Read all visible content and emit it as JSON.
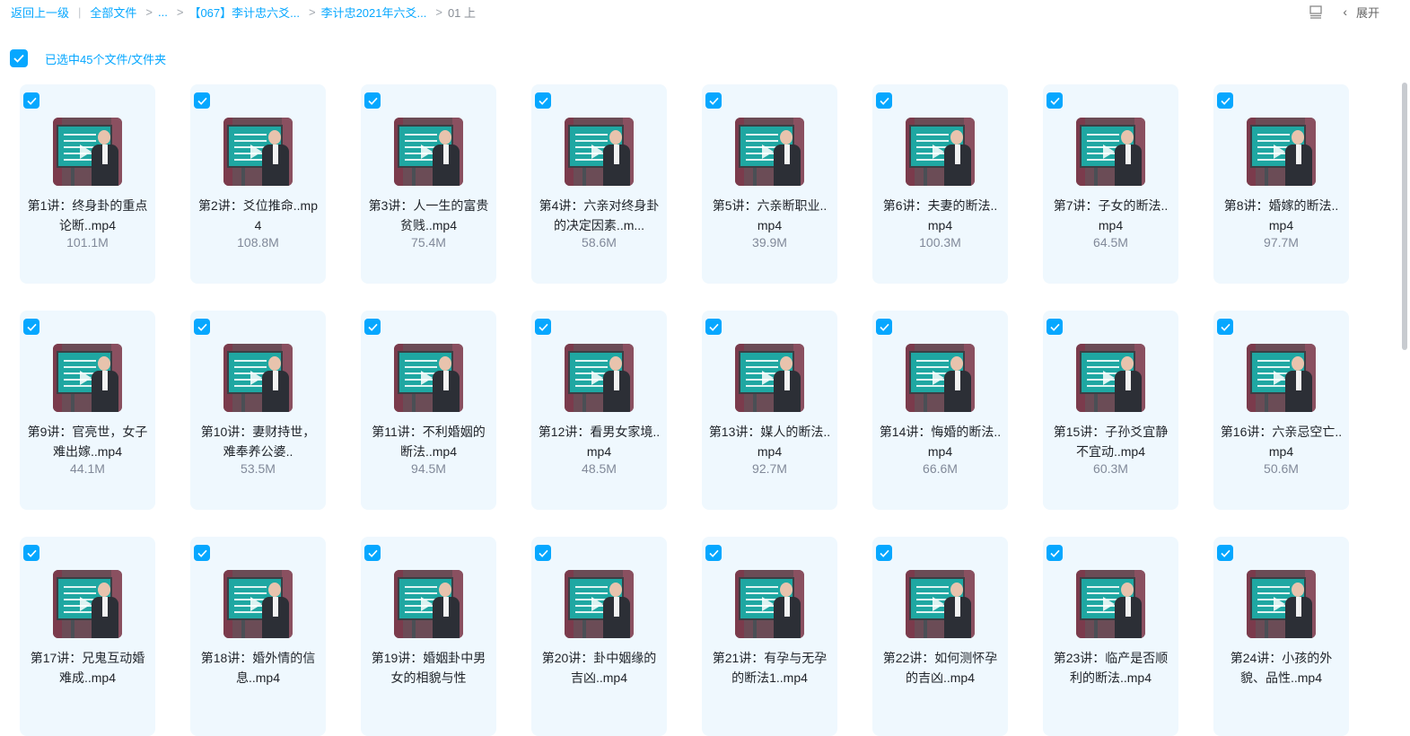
{
  "breadcrumb": {
    "back": "返回上一级",
    "all_files": "全部文件",
    "ellipsis": "...",
    "folder1": "【067】李计忠六爻...",
    "folder2": "李计忠2021年六爻...",
    "current": "01 上"
  },
  "toolbar": {
    "view_icon": "list-view-icon",
    "expand_label": "展开"
  },
  "selection": {
    "label": "已选中45个文件/文件夹",
    "all_checked": true
  },
  "colors": {
    "accent": "#06a7ff",
    "card_bg": "#eff8fe"
  },
  "files": [
    {
      "name": "第1讲：终身卦的重点论断..mp4",
      "size": "101.1M"
    },
    {
      "name": "第2讲：爻位推命..mp4",
      "size": "108.8M"
    },
    {
      "name": "第3讲：人一生的富贵贫贱..mp4",
      "size": "75.4M"
    },
    {
      "name": "第4讲：六亲对终身卦的决定因素..m...",
      "size": "58.6M"
    },
    {
      "name": "第5讲：六亲断职业..mp4",
      "size": "39.9M"
    },
    {
      "name": "第6讲：夫妻的断法..mp4",
      "size": "100.3M"
    },
    {
      "name": "第7讲：子女的断法..mp4",
      "size": "64.5M"
    },
    {
      "name": "第8讲：婚嫁的断法..mp4",
      "size": "97.7M"
    },
    {
      "name": "第9讲：官亮世，女子难出嫁..mp4",
      "size": "44.1M"
    },
    {
      "name": "第10讲：妻财持世，难奉养公婆..",
      "size": "53.5M"
    },
    {
      "name": "第11讲：不利婚姻的断法..mp4",
      "size": "94.5M"
    },
    {
      "name": "第12讲：看男女家境..mp4",
      "size": "48.5M"
    },
    {
      "name": "第13讲：媒人的断法..mp4",
      "size": "92.7M"
    },
    {
      "name": "第14讲：悔婚的断法..mp4",
      "size": "66.6M"
    },
    {
      "name": "第15讲：子孙爻宜静不宜动..mp4",
      "size": "60.3M"
    },
    {
      "name": "第16讲：六亲忌空亡..mp4",
      "size": "50.6M"
    },
    {
      "name": "第17讲：兄鬼互动婚难成..mp4",
      "size": ""
    },
    {
      "name": "第18讲：婚外情的信息..mp4",
      "size": ""
    },
    {
      "name": "第19讲：婚姻卦中男女的相貌与性",
      "size": ""
    },
    {
      "name": "第20讲：卦中姻缘的吉凶..mp4",
      "size": ""
    },
    {
      "name": "第21讲：有孕与无孕的断法1..mp4",
      "size": ""
    },
    {
      "name": "第22讲：如何测怀孕的吉凶..mp4",
      "size": ""
    },
    {
      "name": "第23讲：临产是否顺利的断法..mp4",
      "size": ""
    },
    {
      "name": "第24讲：小孩的外貌、品性..mp4",
      "size": ""
    }
  ]
}
